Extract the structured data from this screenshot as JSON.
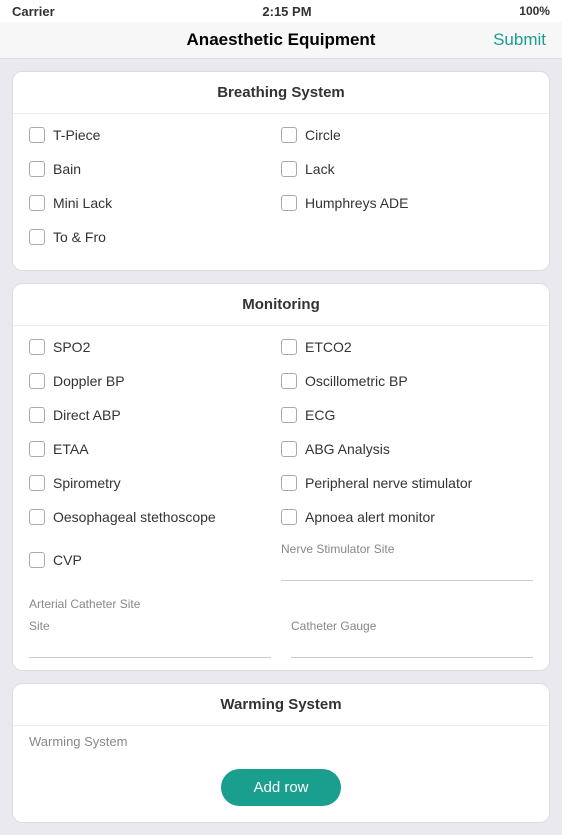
{
  "statusBar": {
    "carrier": "Carrier",
    "wifi": "wifi",
    "time": "2:15 PM",
    "battery": "100%"
  },
  "navBar": {
    "title": "Anaesthetic Equipment",
    "submitLabel": "Submit"
  },
  "breathingSystem": {
    "header": "Breathing System",
    "items": [
      {
        "id": "tpiece",
        "label": "T-Piece",
        "col": 0
      },
      {
        "id": "circle",
        "label": "Circle",
        "col": 1
      },
      {
        "id": "bain",
        "label": "Bain",
        "col": 0
      },
      {
        "id": "lack",
        "label": "Lack",
        "col": 1
      },
      {
        "id": "minilack",
        "label": "Mini Lack",
        "col": 0
      },
      {
        "id": "humphreys",
        "label": "Humphreys ADE",
        "col": 1
      },
      {
        "id": "tofro",
        "label": "To & Fro",
        "col": 0
      }
    ]
  },
  "monitoring": {
    "header": "Monitoring",
    "items": [
      {
        "id": "spo2",
        "label": "SPO2",
        "col": 0
      },
      {
        "id": "etco2",
        "label": "ETCO2",
        "col": 1
      },
      {
        "id": "dopplerbp",
        "label": "Doppler BP",
        "col": 0
      },
      {
        "id": "oscillometric",
        "label": "Oscillometric BP",
        "col": 1
      },
      {
        "id": "directabp",
        "label": "Direct ABP",
        "col": 0
      },
      {
        "id": "ecg",
        "label": "ECG",
        "col": 1
      },
      {
        "id": "etaa",
        "label": "ETAA",
        "col": 0
      },
      {
        "id": "abg",
        "label": "ABG Analysis",
        "col": 1
      },
      {
        "id": "spirometry",
        "label": "Spirometry",
        "col": 0
      },
      {
        "id": "peripheral",
        "label": "Peripheral nerve stimulator",
        "col": 1
      },
      {
        "id": "oesophageal",
        "label": "Oesophageal stethoscope",
        "col": 0
      },
      {
        "id": "apnoea",
        "label": "Apnoea alert monitor",
        "col": 1
      },
      {
        "id": "cvp",
        "label": "CVP",
        "col": 0
      }
    ],
    "nerveStimulatorSiteLabel": "Nerve Stimulator Site",
    "arterialCatheterSiteLabel": "Arterial Catheter Site",
    "siteLabel": "Site",
    "catheterGaugeLabel": "Catheter Gauge"
  },
  "warmingSystem": {
    "header": "Warming System",
    "warmingSystemLabel": "Warming System",
    "addRowLabel": "Add row"
  }
}
